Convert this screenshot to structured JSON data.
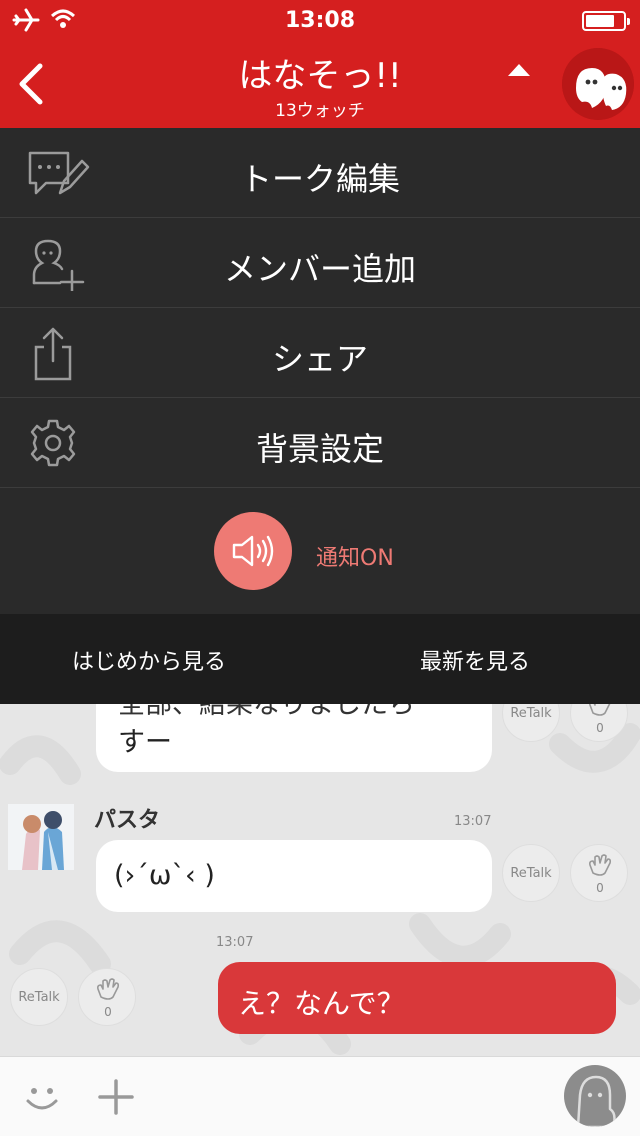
{
  "status_bar": {
    "time": "13:08"
  },
  "header": {
    "title": "はなそっ!!",
    "subtitle": "13ウォッチ"
  },
  "menu": {
    "items": [
      {
        "label": "トーク編集",
        "icon": "edit-talk-icon"
      },
      {
        "label": "メンバー追加",
        "icon": "add-member-icon"
      },
      {
        "label": "シェア",
        "icon": "share-icon"
      },
      {
        "label": "背景設定",
        "icon": "gear-icon"
      }
    ],
    "notification": {
      "label": "通知ON",
      "icon": "speaker-icon"
    }
  },
  "history": {
    "from_start": "はじめから見る",
    "latest": "最新を見る"
  },
  "chat": {
    "messages": [
      {
        "text_line1": "全部、結果なりましたら",
        "text_line2": "すー",
        "retalk": "ReTalk",
        "clap_count": "0"
      },
      {
        "author": "パスタ",
        "time": "13:07",
        "text": "(›´ω`‹ )",
        "retalk": "ReTalk",
        "clap_count": "0"
      },
      {
        "time": "13:07",
        "text": "え？なんで？",
        "retalk": "ReTalk",
        "clap_count": "0",
        "mine": true
      }
    ]
  },
  "colors": {
    "brand": "#d51f1f",
    "menu_bg": "#2a2a2a",
    "accent": "#ee7a74",
    "mine_bubble": "#d9383a"
  }
}
